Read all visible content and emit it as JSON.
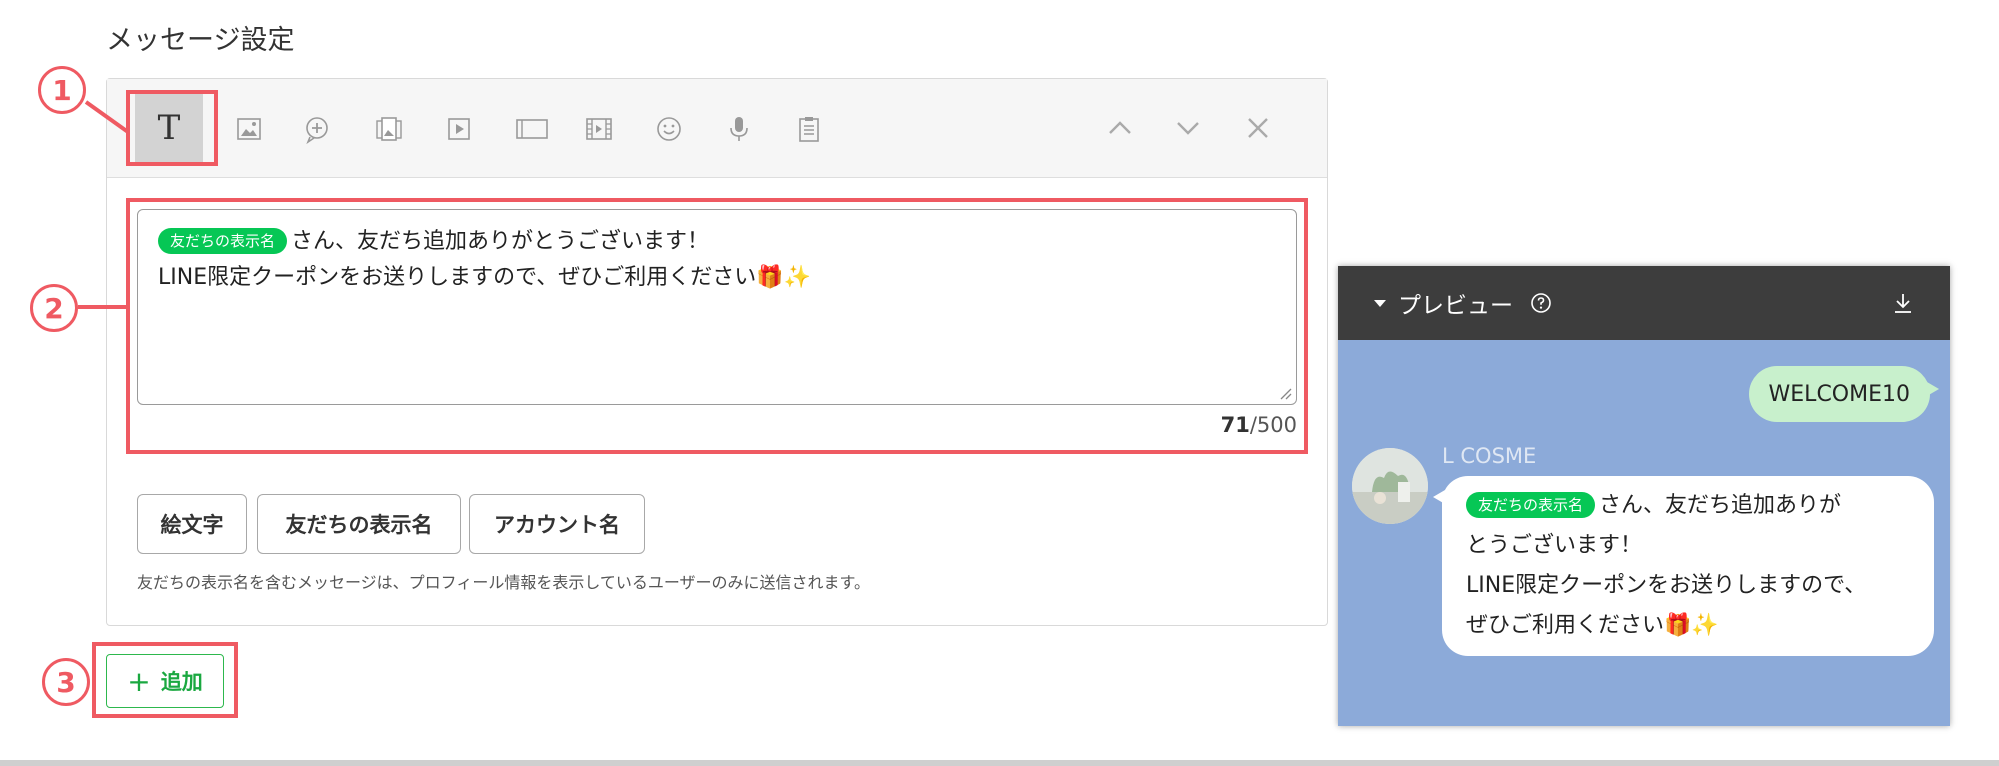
{
  "section_title": "メッセージ設定",
  "toolbar": {
    "text_tool_label": "T",
    "icons": [
      "image-icon",
      "chat-bubble-plus-icon",
      "card-message-icon",
      "play-video-icon",
      "rich-message-icon",
      "film-icon",
      "emoji-icon",
      "microphone-icon",
      "clipboard-icon"
    ],
    "controls": [
      "chevron-up-icon",
      "chevron-down-icon",
      "close-icon"
    ]
  },
  "message": {
    "tag": "友だちの表示名",
    "line1_text": "さん、友だち追加ありがとうございます！",
    "line2_text": "LINE限定クーポンをお送りしますので、ぜひご利用ください🎁✨",
    "count": "71",
    "max": "/500"
  },
  "insert_buttons": {
    "emoji": "絵文字",
    "friend_name": "友だちの表示名",
    "account_name": "アカウント名"
  },
  "note": "友だちの表示名を含むメッセージは、プロフィール情報を表示しているユーザーのみに送信されます。",
  "add_button": {
    "icon": "+",
    "label": "追加"
  },
  "annotations": {
    "one": "1",
    "two": "2",
    "three": "3",
    "color": "#ef5a62"
  },
  "preview": {
    "title": "プレビュー",
    "user_bubble": "WELCOME10",
    "sender_name": "L COSME",
    "tag": "友だちの表示名",
    "line1": "さん、友だち追加ありが",
    "line2": "とうございます！",
    "line3": "LINE限定クーポンをお送りしますので、",
    "line4": "ぜひご利用ください🎁✨"
  },
  "colors": {
    "accent_green": "#06c755",
    "preview_bg": "#8caad9",
    "preview_header": "#3d3d3d"
  }
}
